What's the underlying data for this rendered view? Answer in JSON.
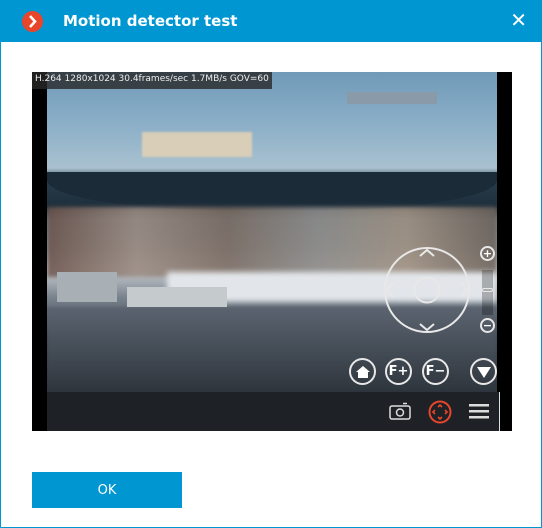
{
  "window": {
    "title": "Motion detector test",
    "close_icon": "close-icon",
    "logo_icon": "chevron-right-logo"
  },
  "video": {
    "stream_info": "H.264 1280x1024 30.4frames/sec 1.7MB/s GOV=60"
  },
  "ptz": {
    "zoom_in": "+",
    "zoom_out": "−",
    "focus_plus": "F+",
    "focus_minus": "F−"
  },
  "toolbar": {
    "icons": [
      "camera-icon",
      "ptz-icon",
      "menu-icon"
    ],
    "ptz_active_color": "#e8452b"
  },
  "footer": {
    "ok_label": "OK"
  },
  "colors": {
    "accent": "#0096d1",
    "logo": "#e8452b"
  }
}
